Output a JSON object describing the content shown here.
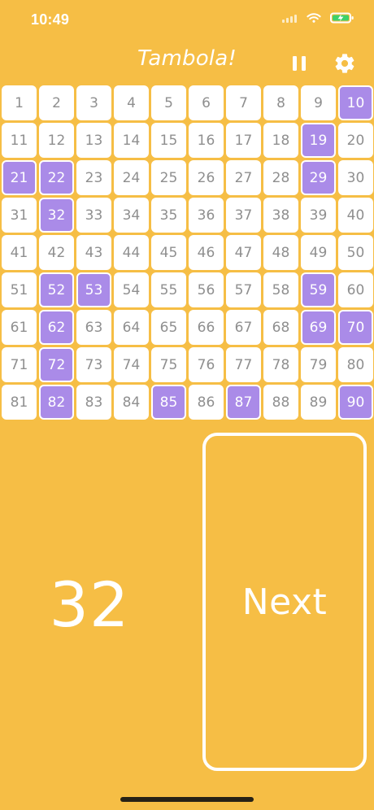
{
  "status_bar": {
    "time": "10:49",
    "icons": {
      "signal": "signal-icon",
      "wifi": "wifi-icon",
      "battery": "battery-charging-icon"
    }
  },
  "header": {
    "title": "Tambola!",
    "pause_icon": "pause-icon",
    "settings_icon": "gear-icon"
  },
  "board": {
    "numbers": [
      1,
      2,
      3,
      4,
      5,
      6,
      7,
      8,
      9,
      10,
      11,
      12,
      13,
      14,
      15,
      16,
      17,
      18,
      19,
      20,
      21,
      22,
      23,
      24,
      25,
      26,
      27,
      28,
      29,
      30,
      31,
      32,
      33,
      34,
      35,
      36,
      37,
      38,
      39,
      40,
      41,
      42,
      43,
      44,
      45,
      46,
      47,
      48,
      49,
      50,
      51,
      52,
      53,
      54,
      55,
      56,
      57,
      58,
      59,
      60,
      61,
      62,
      63,
      64,
      65,
      66,
      67,
      68,
      69,
      70,
      71,
      72,
      73,
      74,
      75,
      76,
      77,
      78,
      79,
      80,
      81,
      82,
      83,
      84,
      85,
      86,
      87,
      88,
      89,
      90
    ],
    "marked": [
      10,
      19,
      21,
      22,
      29,
      32,
      52,
      53,
      59,
      62,
      69,
      70,
      72,
      82,
      85,
      87,
      90
    ]
  },
  "current": {
    "number": "32"
  },
  "next_button": {
    "label": "Next"
  },
  "colors": {
    "background": "#F6BE45",
    "tile": "#FFFFFF",
    "tile_text": "#8F8F8F",
    "marked_tile": "#AA8BE8",
    "marked_text": "#FFFFFF",
    "white": "#FFFFFF"
  }
}
